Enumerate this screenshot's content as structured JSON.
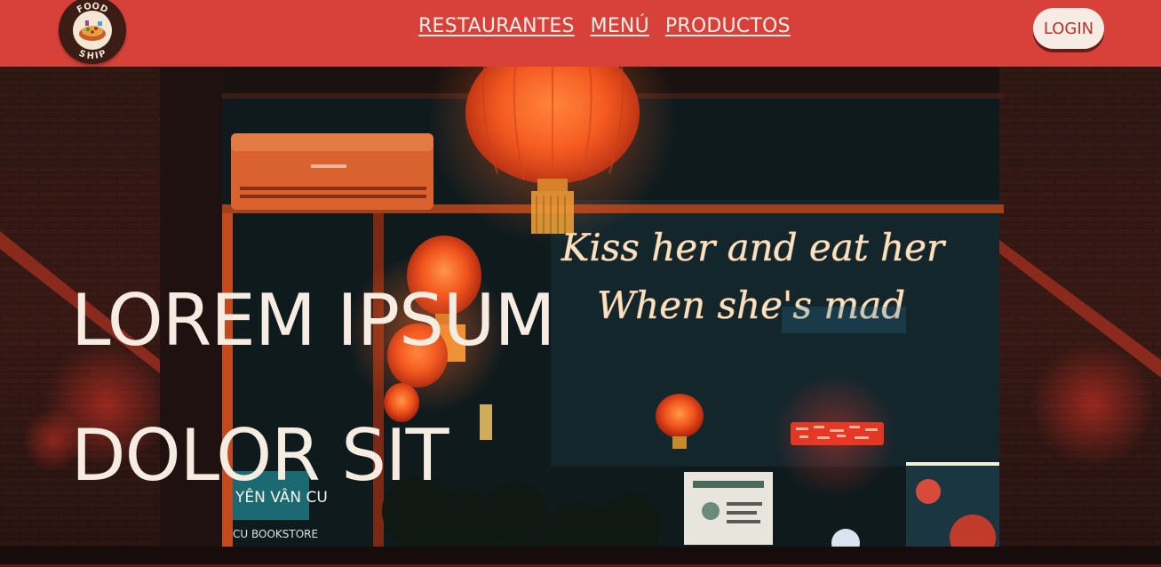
{
  "brand": {
    "logo_top": "FOOD",
    "logo_bottom": "SHIP"
  },
  "nav": {
    "links": [
      "RESTAURANTES",
      "MENÚ",
      "PRODUCTOS"
    ],
    "login_label": "LOGIN"
  },
  "hero": {
    "line1": "LOREM IPSUM",
    "line2": "DOLOR SIT",
    "neon_line1": "Kiss her and eat her",
    "neon_line2": "When she's mad",
    "shop_sign": "YÊN VÂN CU",
    "shop_sign_sub": "CU BOOKSTORE"
  },
  "colors": {
    "navbar": "#d8413a",
    "hero_text": "#f6ece1",
    "login_bg": "#f7ece3"
  }
}
